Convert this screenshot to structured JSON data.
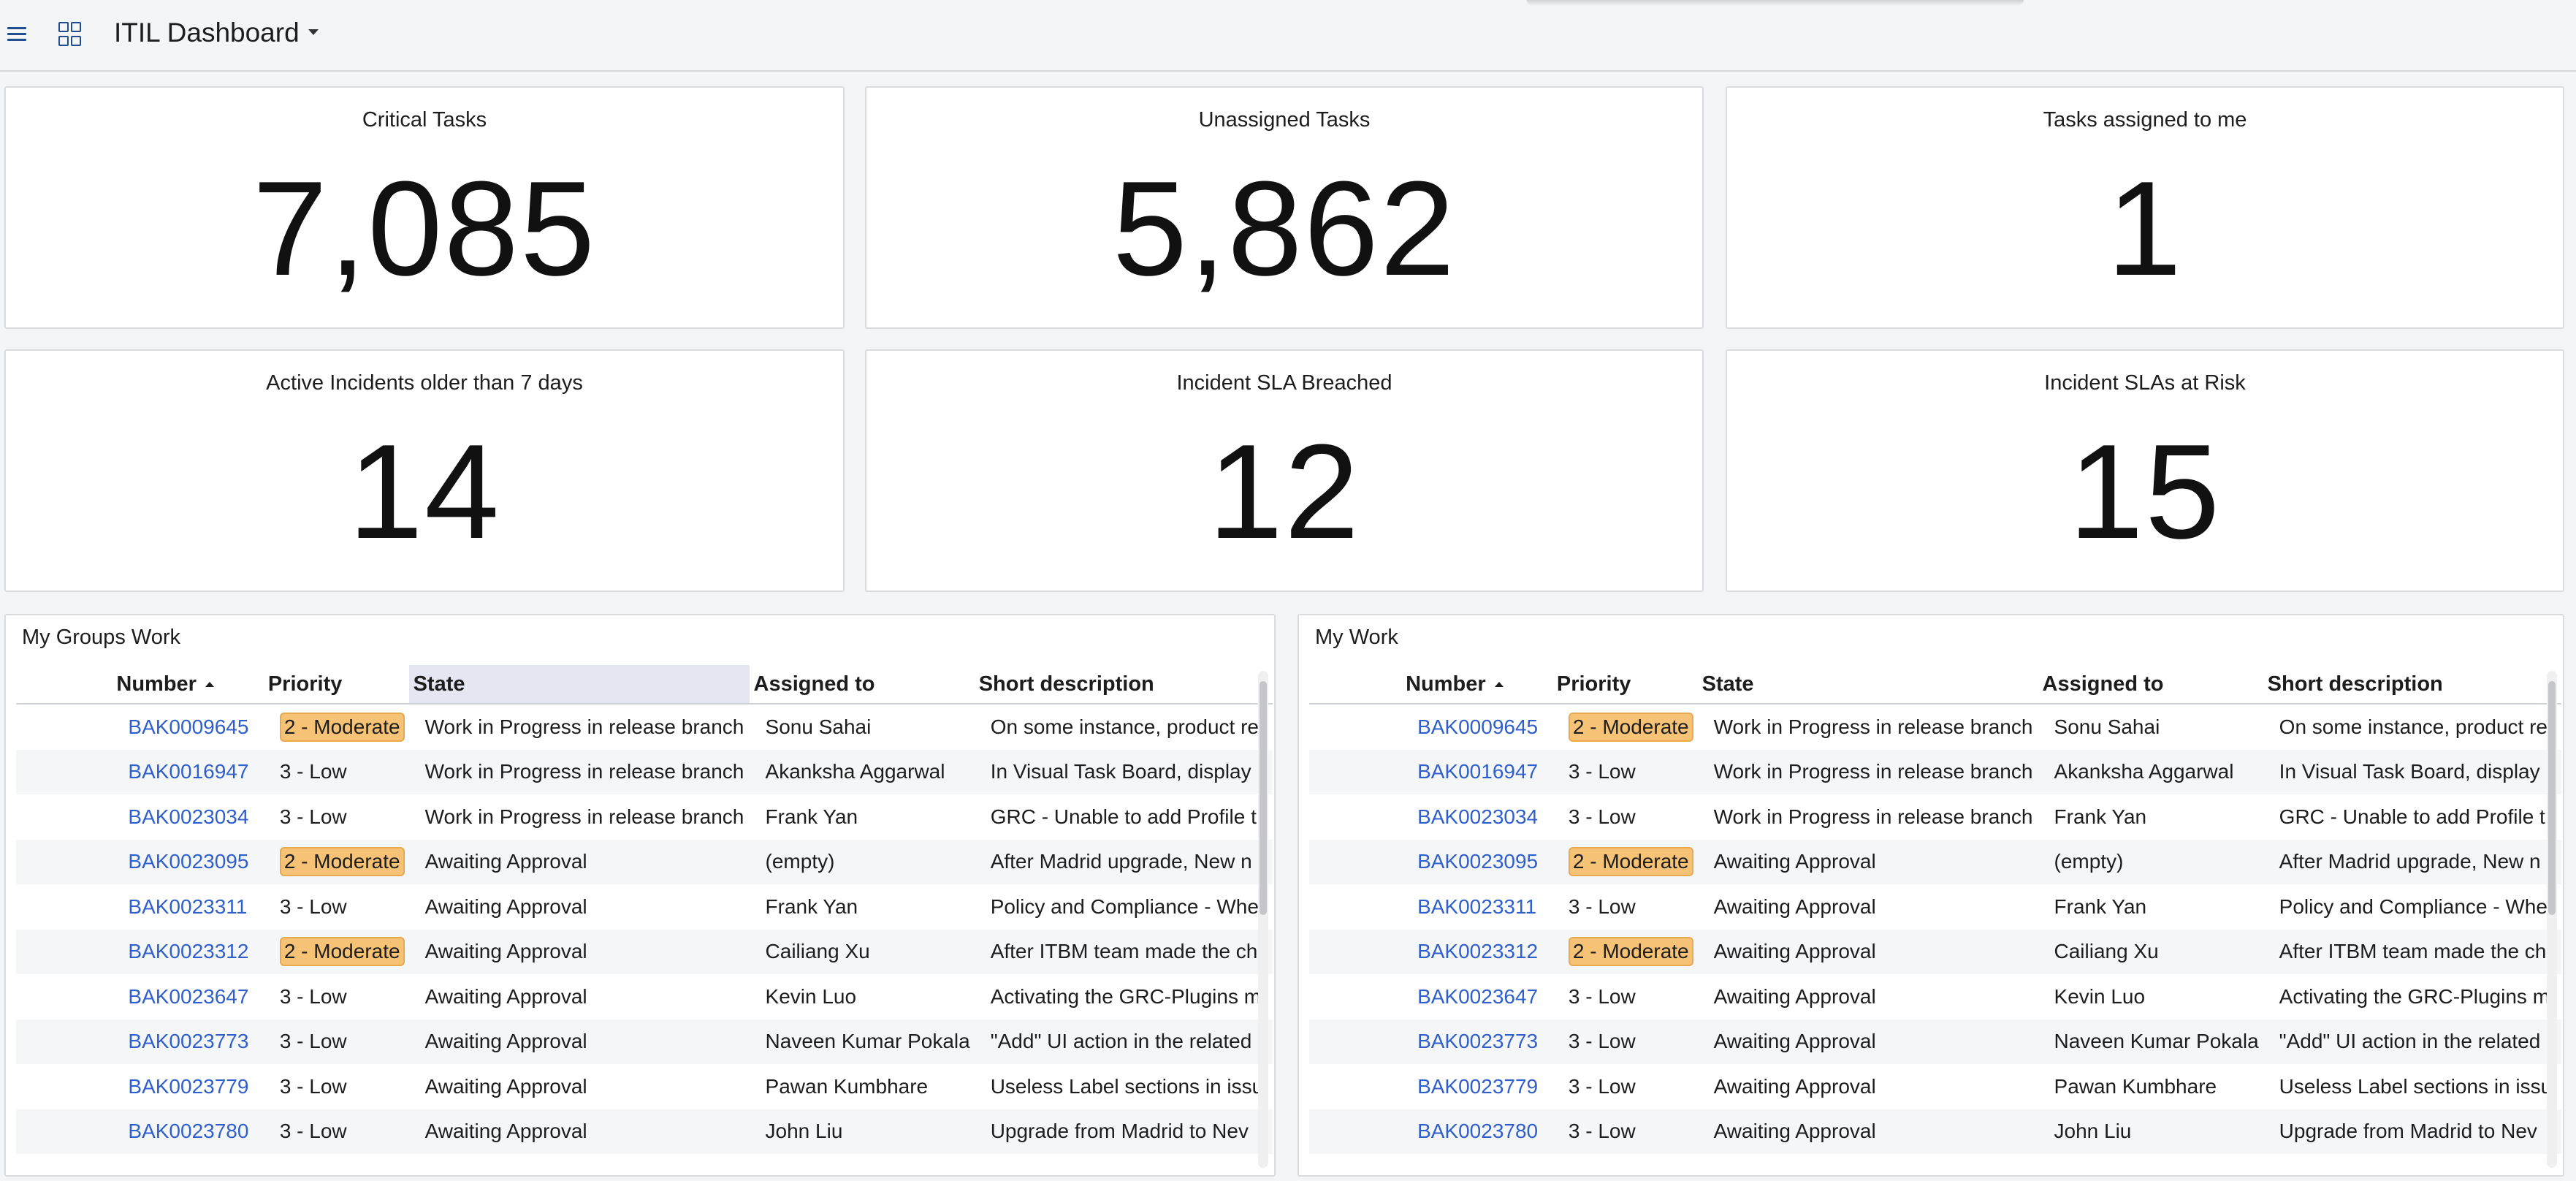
{
  "header": {
    "title": "ITIL Dashboard"
  },
  "cards": [
    {
      "title": "Critical Tasks",
      "value": "7,085"
    },
    {
      "title": "Unassigned Tasks",
      "value": "5,862"
    },
    {
      "title": "Tasks assigned to me",
      "value": "1"
    },
    {
      "title": "Active Incidents older than 7 days",
      "value": "14"
    },
    {
      "title": "Incident SLA Breached",
      "value": "12"
    },
    {
      "title": "Incident SLAs at Risk",
      "value": "15"
    }
  ],
  "columns": [
    "Number",
    "Priority",
    "State",
    "Assigned to",
    "Short description"
  ],
  "rows": [
    {
      "number": "BAK0009645",
      "priority": "2 - Moderate",
      "state": "Work in Progress in release branch",
      "assigned": "Sonu Sahai",
      "desc": "On some instance, product re"
    },
    {
      "number": "BAK0016947",
      "priority": "3 - Low",
      "state": "Work in Progress in release branch",
      "assigned": "Akanksha Aggarwal",
      "desc": "In Visual Task Board, display p"
    },
    {
      "number": "BAK0023034",
      "priority": "3 - Low",
      "state": "Work in Progress in release branch",
      "assigned": "Frank Yan",
      "desc": "GRC - Unable to add Profile t"
    },
    {
      "number": "BAK0023095",
      "priority": "2 - Moderate",
      "state": "Awaiting Approval",
      "assigned": "(empty)",
      "desc": "After Madrid upgrade, New n"
    },
    {
      "number": "BAK0023311",
      "priority": "3 - Low",
      "state": "Awaiting Approval",
      "assigned": "Frank Yan",
      "desc": "Policy and Compliance - Whe"
    },
    {
      "number": "BAK0023312",
      "priority": "2 - Moderate",
      "state": "Awaiting Approval",
      "assigned": "Cailiang Xu",
      "desc": "After ITBM team made the ch"
    },
    {
      "number": "BAK0023647",
      "priority": "3 - Low",
      "state": "Awaiting Approval",
      "assigned": "Kevin Luo",
      "desc": "Activating the GRC-Plugins m"
    },
    {
      "number": "BAK0023773",
      "priority": "3 - Low",
      "state": "Awaiting Approval",
      "assigned": "Naveen Kumar Pokala",
      "desc": "\"Add\" UI action in the related"
    },
    {
      "number": "BAK0023779",
      "priority": "3 - Low",
      "state": "Awaiting Approval",
      "assigned": "Pawan Kumbhare",
      "desc": "Useless Label sections in issu"
    },
    {
      "number": "BAK0023780",
      "priority": "3 - Low",
      "state": "Awaiting Approval",
      "assigned": "John Liu",
      "desc": "Upgrade from Madrid to Nev"
    }
  ],
  "panels": {
    "left": {
      "title": "My Groups Work"
    },
    "right": {
      "title": "My Work"
    }
  }
}
